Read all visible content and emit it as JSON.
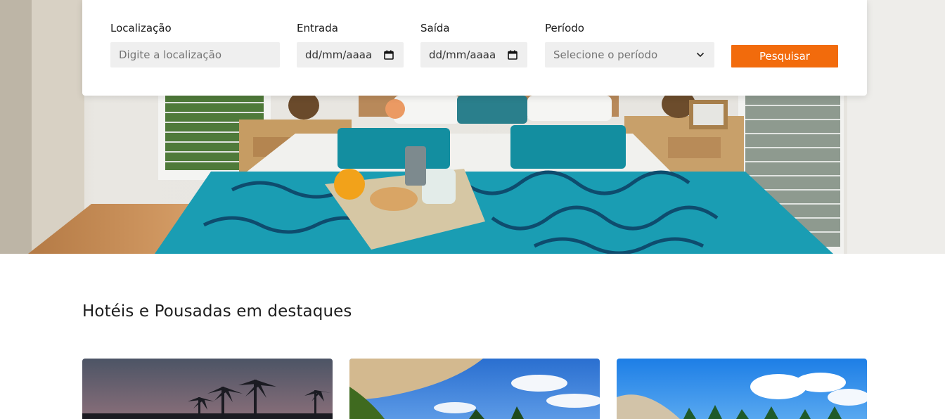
{
  "search": {
    "location_label": "Localização",
    "location_placeholder": "Digite a localização",
    "checkin_label": "Entrada",
    "checkin_value": "dd/mm/aaaa",
    "checkout_label": "Saída",
    "checkout_value": "dd/mm/aaaa",
    "period_label": "Período",
    "period_value": "Selecione o período",
    "button_label": "Pesquisar"
  },
  "featured": {
    "title": "Hotéis e Pousadas em destaques",
    "cards": [
      {
        "image": "sunset-palm-trees-photo"
      },
      {
        "image": "beach-umbrella-palms-photo"
      },
      {
        "image": "tropical-beach-clouds-photo"
      }
    ]
  },
  "colors": {
    "accent": "#f26b0c",
    "field_bg": "#efefef"
  }
}
